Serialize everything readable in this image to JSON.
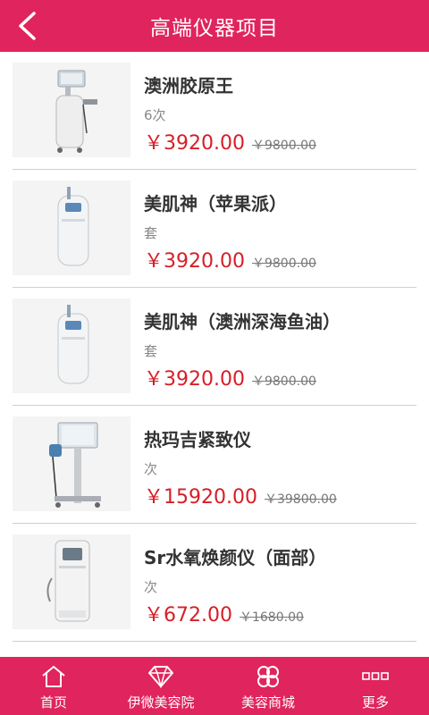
{
  "header": {
    "title": "高端仪器项目",
    "back_icon": "chevron-left-icon"
  },
  "items": [
    {
      "name": "澳洲胶原王",
      "unit": "6次",
      "price": "￥3920.00",
      "orig": "￥9800.00"
    },
    {
      "name": "美肌神（苹果派）",
      "unit": "套",
      "price": "￥3920.00",
      "orig": "￥9800.00"
    },
    {
      "name": "美肌神（澳洲深海鱼油）",
      "unit": "套",
      "price": "￥3920.00",
      "orig": "￥9800.00"
    },
    {
      "name": "热玛吉紧致仪",
      "unit": "次",
      "price": "￥15920.00",
      "orig": "￥39800.00"
    },
    {
      "name": "Sr水氧焕颜仪（面部）",
      "unit": "次",
      "price": "￥672.00",
      "orig": "￥1680.00"
    }
  ],
  "tabbar": {
    "tabs": [
      {
        "label": "首页",
        "icon": "home-icon"
      },
      {
        "label": "伊微美容院",
        "icon": "diamond-icon"
      },
      {
        "label": "美容商城",
        "icon": "clover-icon"
      },
      {
        "label": "更多",
        "icon": "more-icon"
      }
    ]
  },
  "colors": {
    "brand": "#e0245e",
    "price": "#d81e27"
  }
}
